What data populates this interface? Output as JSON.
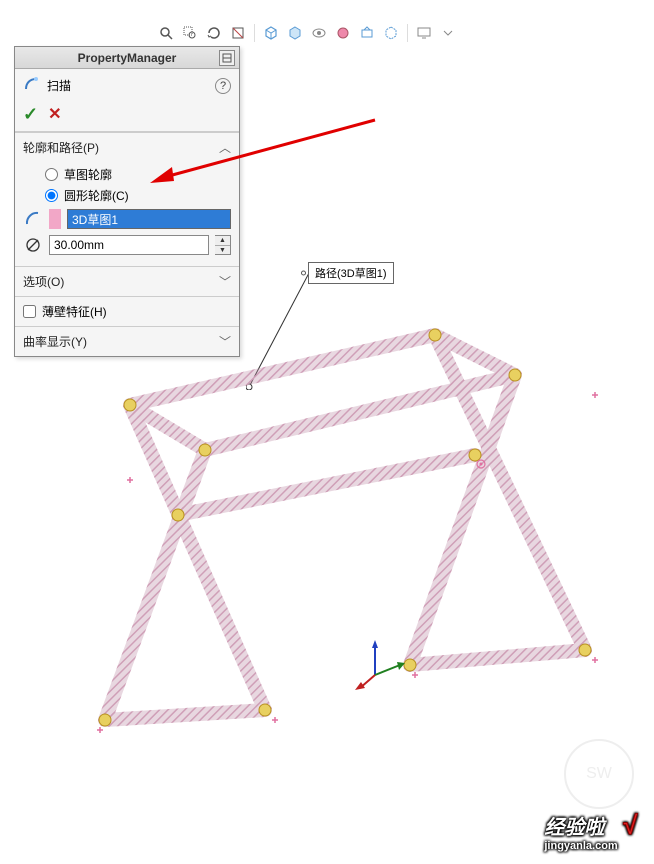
{
  "toolbar": {
    "icons": [
      "zoom-fit",
      "zoom-area",
      "zoom-prev",
      "section",
      "view-orient",
      "display-style",
      "hide-show",
      "appearance",
      "scene",
      "render",
      "screen",
      "cube-dd"
    ]
  },
  "panel": {
    "title": "PropertyManager",
    "feature_label": "扫描",
    "help": "?",
    "ok": "✓",
    "cancel": "✕",
    "section_profile_path": "轮廓和路径(P)",
    "radio_sketch": "草图轮廓",
    "radio_circle": "圆形轮廓(C)",
    "path_value": "3D草图1",
    "diameter_value": "30.00mm",
    "section_options": "选项(O)",
    "check_thin": "薄壁特征(H)",
    "section_curvature": "曲率显示(Y)"
  },
  "callout": {
    "label": "路径(3D草图1)"
  },
  "watermark": {
    "circle": "SW",
    "text": "经验啦",
    "sub": "jingyanla.com",
    "tick": "√"
  },
  "chart_data": null
}
